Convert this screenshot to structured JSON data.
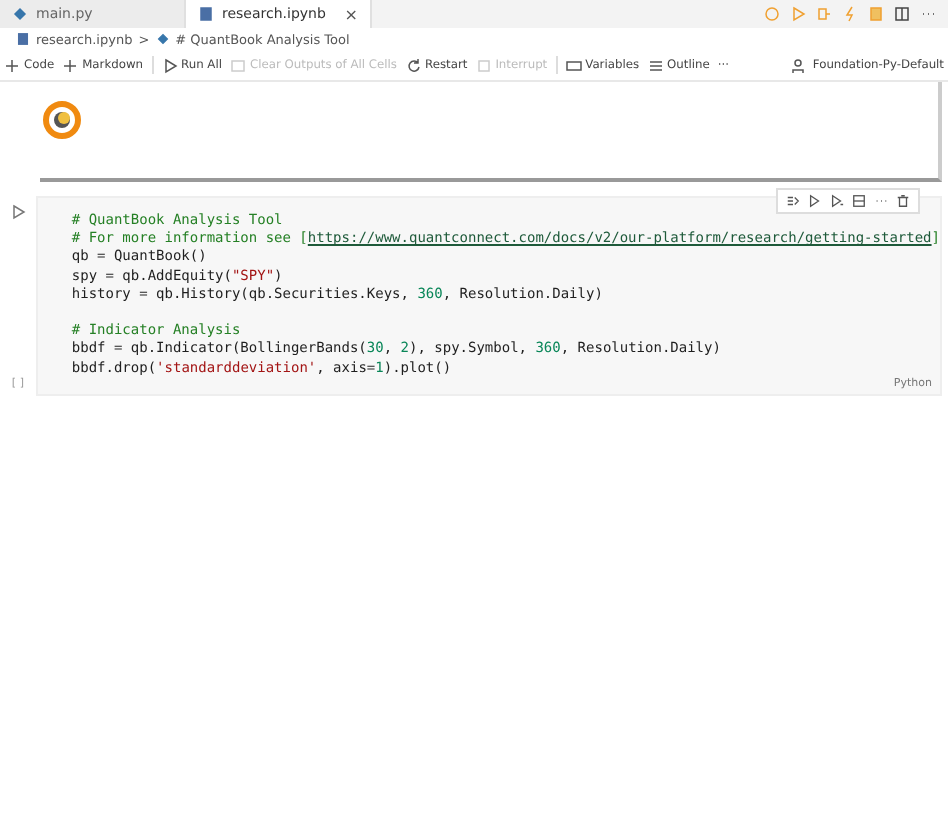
{
  "tabs": [
    {
      "label": "main.py",
      "kind": "python",
      "selected": false
    },
    {
      "label": "research.ipynb",
      "kind": "notebook",
      "selected": true,
      "close": "×"
    }
  ],
  "breadcrumb": [
    "research.ipynb",
    ">",
    "# QuantBook Analysis Tool"
  ],
  "toolbar": [
    {
      "label": "Code",
      "kind": "add",
      "disabled": false
    },
    {
      "label": "Markdown",
      "kind": "add",
      "disabled": false
    },
    {
      "label": "Run All",
      "kind": "run",
      "disabled": false
    },
    {
      "label": "Clear Outputs of All Cells",
      "kind": "clear",
      "disabled": true
    },
    {
      "label": "Restart",
      "kind": "restart",
      "disabled": false
    },
    {
      "label": "Interrupt",
      "kind": "stop",
      "disabled": true
    },
    {
      "label": "Variables",
      "kind": "variables",
      "disabled": false
    },
    {
      "label": "Outline",
      "kind": "outline",
      "disabled": false
    },
    {
      "label": "···",
      "kind": "more",
      "disabled": false
    }
  ],
  "kernel": "Foundation-Py-Default",
  "cell": {
    "language": "Python",
    "brackets": "[ ]",
    "lines": [
      [
        {
          "text": "# QuantBook Analysis Tool",
          "kind": "comment"
        }
      ],
      [
        {
          "text": "# For more information see [",
          "kind": "comment"
        },
        {
          "text": "https://www.quantconnect.com/docs/v2/our-platform/research/getting-started",
          "kind": "link"
        },
        {
          "text": "]",
          "kind": "comment"
        }
      ],
      [
        {
          "text": "qb = QuantBook()",
          "kind": "plain"
        }
      ],
      [
        {
          "text": "spy = qb.AddEquity(",
          "kind": "plain"
        },
        {
          "text": "\"SPY\"",
          "kind": "string"
        },
        {
          "text": ")",
          "kind": "plain"
        }
      ],
      [
        {
          "text": "history = qb.History(qb.Securities.Keys, ",
          "kind": "plain"
        },
        {
          "text": "360",
          "kind": "number"
        },
        {
          "text": ", Resolution.Daily)",
          "kind": "plain"
        }
      ],
      [
        {
          "text": "# Indicator Analysis",
          "kind": "comment",
          "gap_before": true
        }
      ],
      [
        {
          "text": "bbdf = qb.Indicator(BollingerBands(",
          "kind": "plain"
        },
        {
          "text": "30",
          "kind": "number"
        },
        {
          "text": ", ",
          "kind": "plain"
        },
        {
          "text": "2",
          "kind": "number"
        },
        {
          "text": "), spy.Symbol, ",
          "kind": "plain"
        },
        {
          "text": "360",
          "kind": "number"
        },
        {
          "text": ", Resolution.Daily)",
          "kind": "plain"
        }
      ],
      [
        {
          "text": "bbdf.drop(",
          "kind": "plain"
        },
        {
          "text": "'standarddeviation'",
          "kind": "string"
        },
        {
          "text": ", axis=",
          "kind": "plain"
        },
        {
          "text": "1",
          "kind": "number"
        },
        {
          "text": ").plot()",
          "kind": "plain"
        }
      ]
    ]
  }
}
